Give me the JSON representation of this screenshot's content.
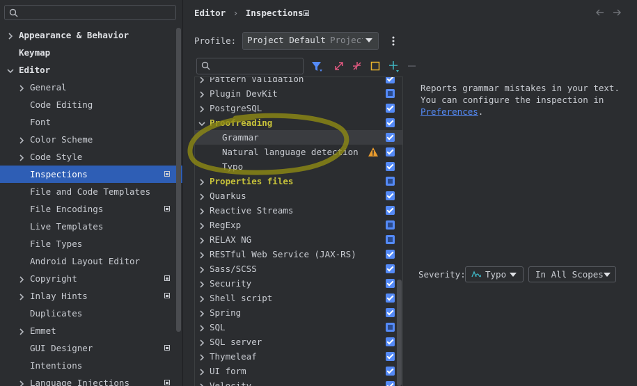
{
  "sidebar": {
    "items": [
      {
        "label": "Appearance & Behavior",
        "level": 0,
        "chevron": "right",
        "bold": true,
        "badge": false,
        "selected": false
      },
      {
        "label": "Keymap",
        "level": 0,
        "chevron": "none",
        "bold": true,
        "badge": false,
        "selected": false
      },
      {
        "label": "Editor",
        "level": 0,
        "chevron": "down",
        "bold": true,
        "badge": false,
        "selected": false
      },
      {
        "label": "General",
        "level": 1,
        "chevron": "right",
        "bold": false,
        "badge": false,
        "selected": false
      },
      {
        "label": "Code Editing",
        "level": 1,
        "chevron": "none",
        "bold": false,
        "badge": false,
        "selected": false
      },
      {
        "label": "Font",
        "level": 1,
        "chevron": "none",
        "bold": false,
        "badge": false,
        "selected": false
      },
      {
        "label": "Color Scheme",
        "level": 1,
        "chevron": "right",
        "bold": false,
        "badge": false,
        "selected": false
      },
      {
        "label": "Code Style",
        "level": 1,
        "chevron": "right",
        "bold": false,
        "badge": false,
        "selected": false
      },
      {
        "label": "Inspections",
        "level": 1,
        "chevron": "none",
        "bold": false,
        "badge": true,
        "selected": true
      },
      {
        "label": "File and Code Templates",
        "level": 1,
        "chevron": "none",
        "bold": false,
        "badge": false,
        "selected": false
      },
      {
        "label": "File Encodings",
        "level": 1,
        "chevron": "none",
        "bold": false,
        "badge": true,
        "selected": false
      },
      {
        "label": "Live Templates",
        "level": 1,
        "chevron": "none",
        "bold": false,
        "badge": false,
        "selected": false
      },
      {
        "label": "File Types",
        "level": 1,
        "chevron": "none",
        "bold": false,
        "badge": false,
        "selected": false
      },
      {
        "label": "Android Layout Editor",
        "level": 1,
        "chevron": "none",
        "bold": false,
        "badge": false,
        "selected": false
      },
      {
        "label": "Copyright",
        "level": 1,
        "chevron": "right",
        "bold": false,
        "badge": true,
        "selected": false
      },
      {
        "label": "Inlay Hints",
        "level": 1,
        "chevron": "right",
        "bold": false,
        "badge": true,
        "selected": false
      },
      {
        "label": "Duplicates",
        "level": 1,
        "chevron": "none",
        "bold": false,
        "badge": false,
        "selected": false
      },
      {
        "label": "Emmet",
        "level": 1,
        "chevron": "right",
        "bold": false,
        "badge": false,
        "selected": false
      },
      {
        "label": "GUI Designer",
        "level": 1,
        "chevron": "none",
        "bold": false,
        "badge": true,
        "selected": false
      },
      {
        "label": "Intentions",
        "level": 1,
        "chevron": "none",
        "bold": false,
        "badge": false,
        "selected": false
      },
      {
        "label": "Language Injections",
        "level": 1,
        "chevron": "right",
        "bold": false,
        "badge": true,
        "selected": false
      }
    ]
  },
  "header": {
    "crumb1": "Editor",
    "sep": "›",
    "crumb2": "Inspections"
  },
  "profile": {
    "label": "Profile:",
    "value": "Project Default",
    "scope": "Project"
  },
  "tree": {
    "rows": [
      {
        "label": "Pattern Validation",
        "indent": 0,
        "chevron": "right",
        "color": "#c9ccd2",
        "check": "full",
        "warn": false,
        "hl": false
      },
      {
        "label": "Plugin DevKit",
        "indent": 0,
        "chevron": "right",
        "color": "#c9ccd2",
        "check": "part",
        "warn": false,
        "hl": false
      },
      {
        "label": "PostgreSQL",
        "indent": 0,
        "chevron": "right",
        "color": "#c9ccd2",
        "check": "full",
        "warn": false,
        "hl": false
      },
      {
        "label": "Proofreading",
        "indent": 0,
        "chevron": "down",
        "color": "#c7c23a",
        "check": "full",
        "warn": false,
        "hl": false
      },
      {
        "label": "Grammar",
        "indent": 1,
        "chevron": "none",
        "color": "#c9ccd2",
        "check": "full",
        "warn": false,
        "hl": true
      },
      {
        "label": "Natural language detection",
        "indent": 1,
        "chevron": "none",
        "color": "#c9ccd2",
        "check": "full",
        "warn": true,
        "hl": false
      },
      {
        "label": "Typo",
        "indent": 1,
        "chevron": "none",
        "color": "#c9ccd2",
        "check": "full",
        "warn": false,
        "hl": false
      },
      {
        "label": "Properties files",
        "indent": 0,
        "chevron": "right",
        "color": "#c7c23a",
        "check": "part",
        "warn": false,
        "hl": false
      },
      {
        "label": "Quarkus",
        "indent": 0,
        "chevron": "right",
        "color": "#c9ccd2",
        "check": "full",
        "warn": false,
        "hl": false
      },
      {
        "label": "Reactive Streams",
        "indent": 0,
        "chevron": "right",
        "color": "#c9ccd2",
        "check": "full",
        "warn": false,
        "hl": false
      },
      {
        "label": "RegExp",
        "indent": 0,
        "chevron": "right",
        "color": "#c9ccd2",
        "check": "part",
        "warn": false,
        "hl": false
      },
      {
        "label": "RELAX NG",
        "indent": 0,
        "chevron": "right",
        "color": "#c9ccd2",
        "check": "part",
        "warn": false,
        "hl": false
      },
      {
        "label": "RESTful Web Service (JAX-RS)",
        "indent": 0,
        "chevron": "right",
        "color": "#c9ccd2",
        "check": "full",
        "warn": false,
        "hl": false
      },
      {
        "label": "Sass/SCSS",
        "indent": 0,
        "chevron": "right",
        "color": "#c9ccd2",
        "check": "full",
        "warn": false,
        "hl": false
      },
      {
        "label": "Security",
        "indent": 0,
        "chevron": "right",
        "color": "#c9ccd2",
        "check": "full",
        "warn": false,
        "hl": false
      },
      {
        "label": "Shell script",
        "indent": 0,
        "chevron": "right",
        "color": "#c9ccd2",
        "check": "full",
        "warn": false,
        "hl": false
      },
      {
        "label": "Spring",
        "indent": 0,
        "chevron": "right",
        "color": "#c9ccd2",
        "check": "full",
        "warn": false,
        "hl": false
      },
      {
        "label": "SQL",
        "indent": 0,
        "chevron": "right",
        "color": "#c9ccd2",
        "check": "part",
        "warn": false,
        "hl": false
      },
      {
        "label": "SQL server",
        "indent": 0,
        "chevron": "right",
        "color": "#c9ccd2",
        "check": "full",
        "warn": false,
        "hl": false
      },
      {
        "label": "Thymeleaf",
        "indent": 0,
        "chevron": "right",
        "color": "#c9ccd2",
        "check": "full",
        "warn": false,
        "hl": false
      },
      {
        "label": "UI form",
        "indent": 0,
        "chevron": "right",
        "color": "#c9ccd2",
        "check": "full",
        "warn": false,
        "hl": false
      },
      {
        "label": "Velocity",
        "indent": 0,
        "chevron": "right",
        "color": "#c9ccd2",
        "check": "full",
        "warn": false,
        "hl": false
      }
    ]
  },
  "description": {
    "line1": "Reports grammar mistakes in your text.",
    "line2": "You can configure the inspection in",
    "link": "Preferences",
    "tail": "."
  },
  "severity": {
    "label": "Severity:",
    "value": "Typo",
    "scope": "In All Scopes"
  },
  "icons": {
    "search": "search-icon",
    "filter": "filter-icon",
    "expand": "expand-all-icon",
    "collapse": "collapse-all-icon",
    "reset": "reset-icon",
    "add": "add-icon",
    "remove": "remove-icon",
    "more": "more-icon",
    "back": "back-arrow-icon",
    "forward": "forward-arrow-icon"
  },
  "colors": {
    "accent": "#548af7",
    "selection": "#2e5eb5",
    "highlight": "#c7c23a",
    "warning": "#e89b2d",
    "annotation": "#c7c23a"
  }
}
